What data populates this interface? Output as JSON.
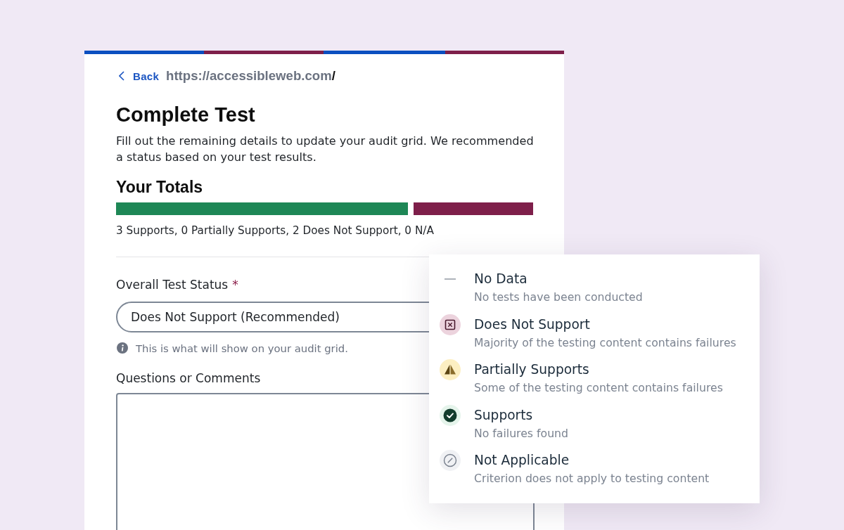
{
  "header": {
    "back_link": "Back",
    "breadcrumb": {
      "site": "https://accessibleweb.com",
      "current": "/"
    }
  },
  "title": "Complete Test",
  "description": "Fill out the remaining details to update your audit grid. We recommended a status based on your test results.",
  "totals": {
    "heading": "Your Totals",
    "level": 0.713,
    "summary": "3 Supports, 0 Partially Supports, 2 Does Not Support, 0 N/A"
  },
  "form": {
    "status_label": "Overall Test Status",
    "required_mark": "*",
    "status_value": "Does Not Support (Recommended)",
    "status_hint": "This is what will show on your audit grid.",
    "comments_label": "Questions or Comments"
  },
  "status_legend": {
    "items": [
      {
        "kind": "no-data",
        "title": "No Data",
        "description": "No tests have been conducted"
      },
      {
        "kind": "does-not-support",
        "title": "Does Not Support",
        "description": "Majority of the testing content contains failures"
      },
      {
        "kind": "partially-supports",
        "title": "Partially Supports",
        "description": "Some of the testing content contains failures"
      },
      {
        "kind": "supports",
        "title": "Supports",
        "description": "No failures found"
      },
      {
        "kind": "not-applicable",
        "title": "Not Applicable",
        "description": "Criterion does not apply to testing content"
      }
    ]
  }
}
